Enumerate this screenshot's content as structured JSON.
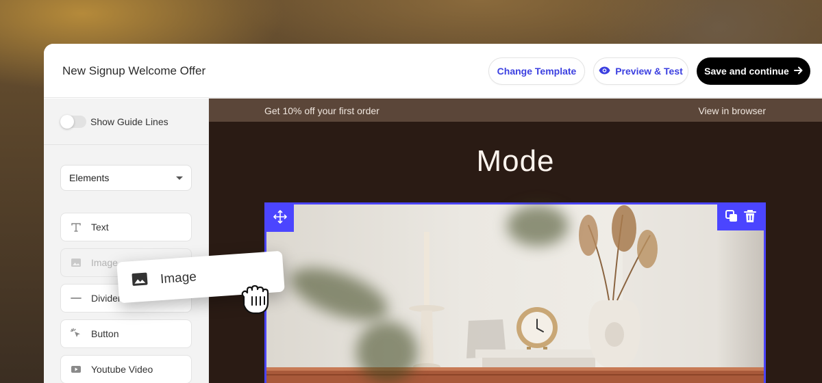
{
  "header": {
    "title": "New Signup Welcome Offer",
    "change_template": "Change Template",
    "preview_test": "Preview & Test",
    "save_continue": "Save and continue"
  },
  "sidebar": {
    "guide_lines_label": "Show Guide Lines",
    "guide_lines_on": false,
    "select_value": "Elements",
    "items": [
      {
        "label": "Text",
        "icon": "text-icon"
      },
      {
        "label": "Image",
        "icon": "image-icon"
      },
      {
        "label": "Divider",
        "icon": "divider-icon"
      },
      {
        "label": "Button",
        "icon": "cursor-click-icon"
      },
      {
        "label": "Youtube Video",
        "icon": "video-icon"
      }
    ]
  },
  "drag_preview": {
    "label": "Image",
    "icon": "image-icon"
  },
  "email": {
    "preheader_left": "Get 10% off your first order",
    "preheader_right": "View in browser",
    "brand": "Mode"
  },
  "colors": {
    "accent": "#4b45ff",
    "link": "#3b3fe0",
    "email_bg": "#2a1b14",
    "preheader_bg": "#5b4639"
  }
}
